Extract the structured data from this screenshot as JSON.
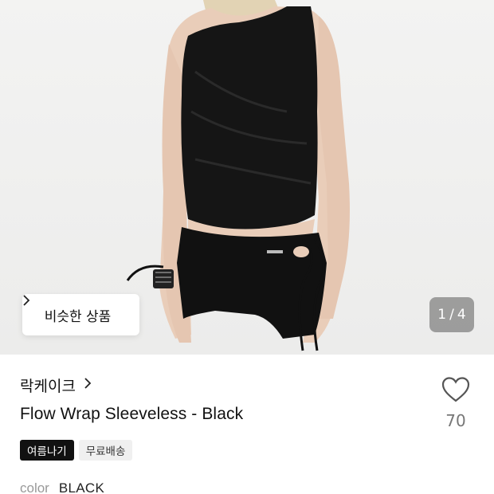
{
  "gallery": {
    "similar_button_label": "비슷한 상품",
    "current_page": "1",
    "separator": "/",
    "total_pages": "4"
  },
  "product": {
    "brand": "락케이크",
    "title": "Flow Wrap Sleeveless - Black",
    "like_count": "70",
    "tags": [
      "여름나기",
      "무료배송"
    ],
    "option_label": "color",
    "option_value": "BLACK"
  },
  "icons": [
    "chevron-right-icon",
    "heart-outline-icon"
  ],
  "colors": {
    "tag_dark_bg": "#111111",
    "tag_light_bg": "#f0f0f0",
    "muted_text": "#777777"
  }
}
